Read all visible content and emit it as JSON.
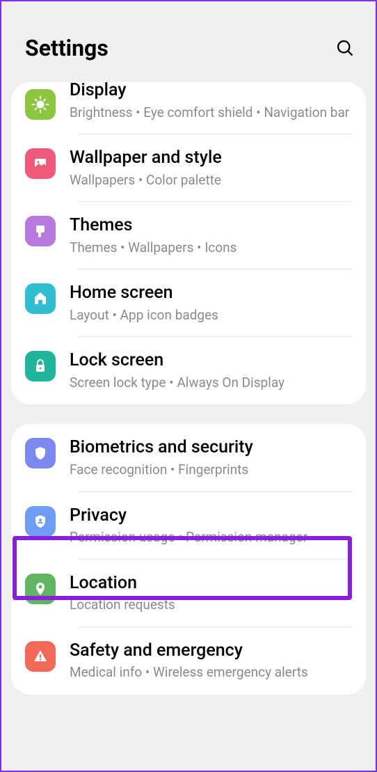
{
  "header": {
    "title": "Settings"
  },
  "sections": [
    {
      "items": [
        {
          "title": "Display",
          "subtitle": "Brightness  •  Eye comfort shield  •  Navigation bar",
          "icon": "sun",
          "color": "#8cc63f"
        },
        {
          "title": "Wallpaper and style",
          "subtitle": "Wallpapers  •  Color palette",
          "icon": "picture",
          "color": "#f05a7a"
        },
        {
          "title": "Themes",
          "subtitle": "Themes  •  Wallpapers  •  Icons",
          "icon": "brush",
          "color": "#b57adb"
        },
        {
          "title": "Home screen",
          "subtitle": "Layout  •  App icon badges",
          "icon": "home",
          "color": "#30bfd0"
        },
        {
          "title": "Lock screen",
          "subtitle": "Screen lock type  •  Always On Display",
          "icon": "lock",
          "color": "#1fb59a"
        }
      ]
    },
    {
      "items": [
        {
          "title": "Biometrics and security",
          "subtitle": "Face recognition  •  Fingerprints",
          "icon": "shield",
          "color": "#7a88f0"
        },
        {
          "title": "Privacy",
          "subtitle": "Permission usage  •  Permission manager",
          "icon": "shield-person",
          "color": "#6f9df5"
        },
        {
          "title": "Location",
          "subtitle": "Location requests",
          "icon": "pin",
          "color": "#5fb560"
        },
        {
          "title": "Safety and emergency",
          "subtitle": "Medical info  •  Wireless emergency alerts",
          "icon": "alert",
          "color": "#f26957"
        }
      ]
    }
  ]
}
